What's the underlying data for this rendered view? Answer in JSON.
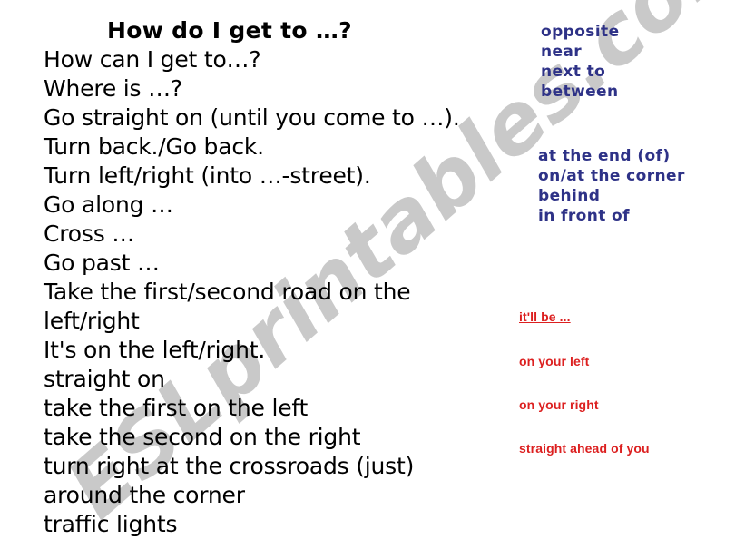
{
  "worksheet": {
    "title": "How do I get to …?",
    "watermark": "ESLprintables.com",
    "colors": {
      "black_text": "#000000",
      "blue_text": "#2e3287",
      "red_text": "#dc2020",
      "watermark": "#c9c9c9",
      "background": "#ffffff"
    }
  },
  "phrases": {
    "lines": [
      "How can I get to…?",
      "Where is …?",
      "Go straight on (until you come to …).",
      "Turn back./Go back.",
      "Turn left/right (into …-street).",
      "Go along …",
      "Cross …",
      "Go past …",
      "Take the first/second road on the",
      "left/right",
      "It's on the left/right.",
      "straight  on",
      "take the first on the left",
      "take the second on the right",
      "turn right at the crossroads (just)",
      "around the corner",
      "traffic lights"
    ]
  },
  "prepositions": {
    "group_one": [
      "opposite",
      "near",
      "next to",
      "between"
    ],
    "group_two": [
      "at the end (of)",
      "on/at the corner",
      "behind",
      "in front of"
    ]
  },
  "responses": {
    "heading": "it'll be ...",
    "items": [
      "on your left",
      "on your right",
      "straight ahead of you"
    ]
  }
}
